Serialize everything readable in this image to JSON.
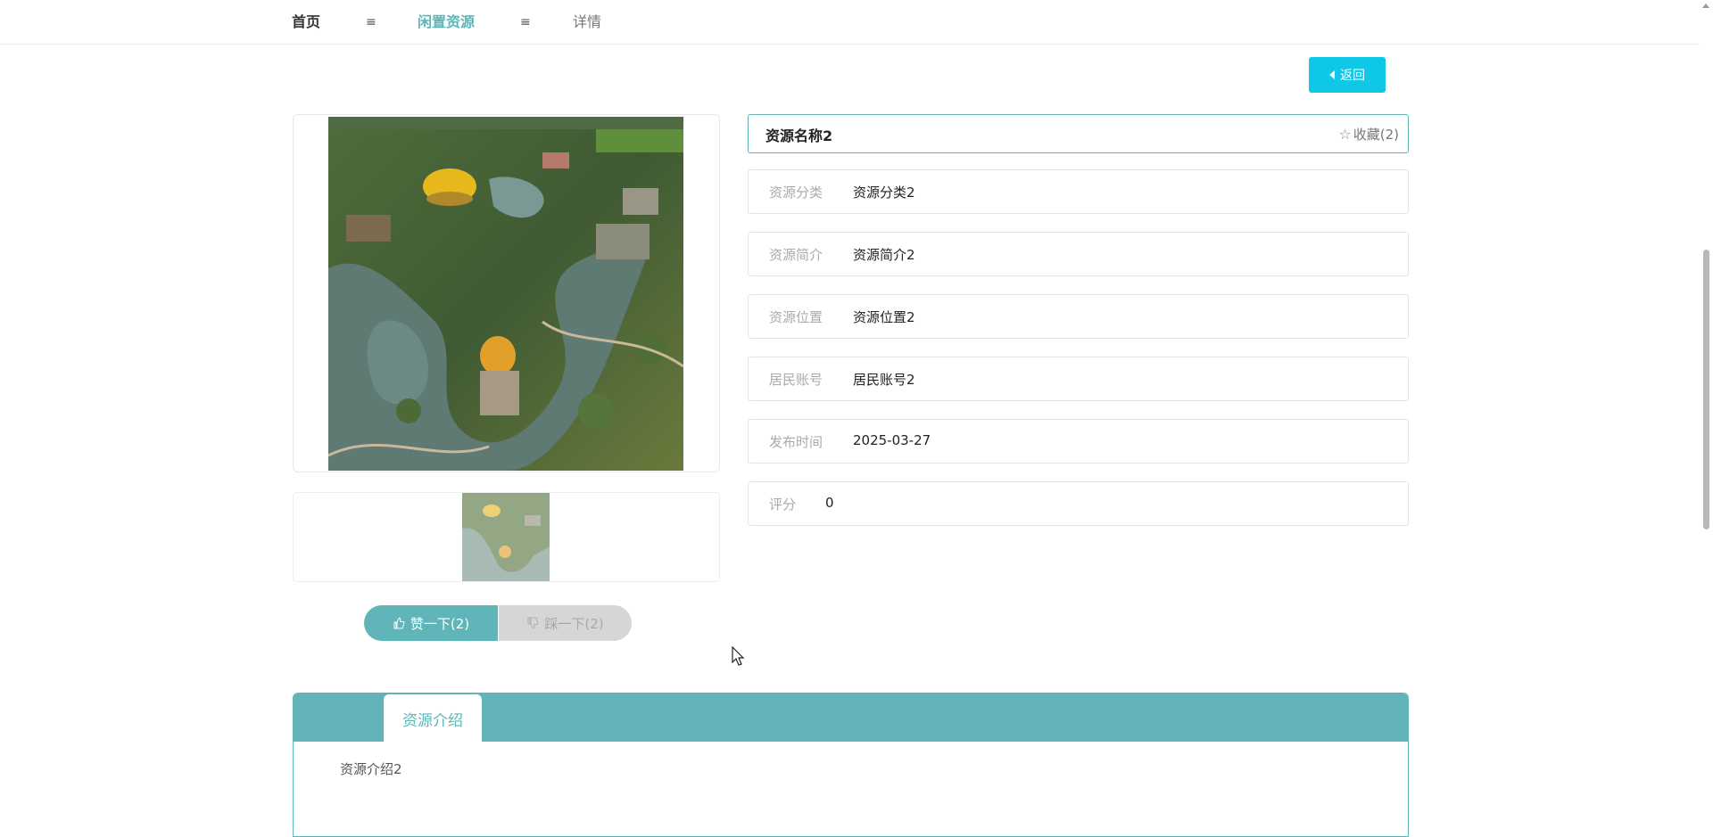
{
  "breadcrumb": {
    "home": "首页",
    "separator": "≡",
    "section": "闲置资源",
    "current": "详情"
  },
  "back_button": {
    "label": "返回"
  },
  "resource": {
    "name": "资源名称2",
    "favorite_label": "收藏(2)",
    "fields": [
      {
        "label": "资源分类",
        "value": "资源分类2"
      },
      {
        "label": "资源简介",
        "value": "资源简介2"
      },
      {
        "label": "资源位置",
        "value": "资源位置2"
      },
      {
        "label": "居民账号",
        "value": "居民账号2"
      },
      {
        "label": "发布时间",
        "value": "2025-03-27"
      },
      {
        "label": "评分",
        "value": "0"
      }
    ]
  },
  "vote": {
    "like_label": "赞一下(2)",
    "dislike_label": "踩一下(2)"
  },
  "tabs": [
    {
      "label": "资源介绍",
      "content": "资源介绍2"
    }
  ],
  "colors": {
    "accent": "#5fb5b8",
    "back_button": "#0fc7e6",
    "dislike_bg": "#d6d6d6"
  },
  "icons": {
    "back": "caret-left-icon",
    "favorite": "star-outline-icon",
    "like": "thumb-up-icon",
    "dislike": "thumb-down-icon"
  }
}
